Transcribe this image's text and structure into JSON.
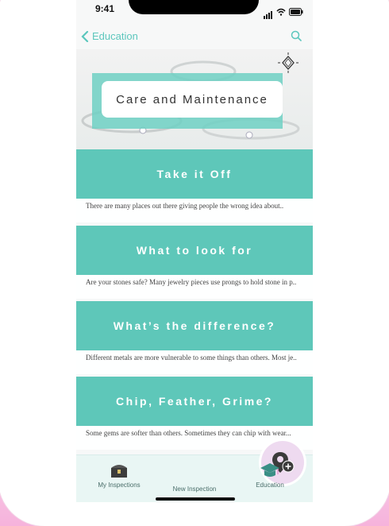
{
  "status": {
    "time": "9:41"
  },
  "nav": {
    "back_label": "Education"
  },
  "hero": {
    "title": "Care and Maintenance"
  },
  "sections": [
    {
      "title": "Take it Off",
      "desc": "There are many places out there giving people the wrong idea about.."
    },
    {
      "title": "What to look for",
      "desc": "Are your stones safe? Many jewelry pieces use prongs to hold stone in p.."
    },
    {
      "title": "What’s the difference?",
      "desc": "Different metals are more vulnerable to some things than others. Most je.."
    },
    {
      "title": "Chip, Feather, Grime?",
      "desc": "Some gems are softer than others. Sometimes they can chip with wear..."
    }
  ],
  "tabbar": {
    "items": [
      {
        "label": "My Inspections",
        "icon": "chest-icon"
      },
      {
        "label": "New Inspection",
        "icon": "location-add-icon"
      },
      {
        "label": "Education",
        "icon": "graduation-cap-icon"
      }
    ]
  },
  "colors": {
    "accent": "#5ec7b9",
    "nav_link": "#5cc7bd",
    "fab": "#eedaf0"
  }
}
